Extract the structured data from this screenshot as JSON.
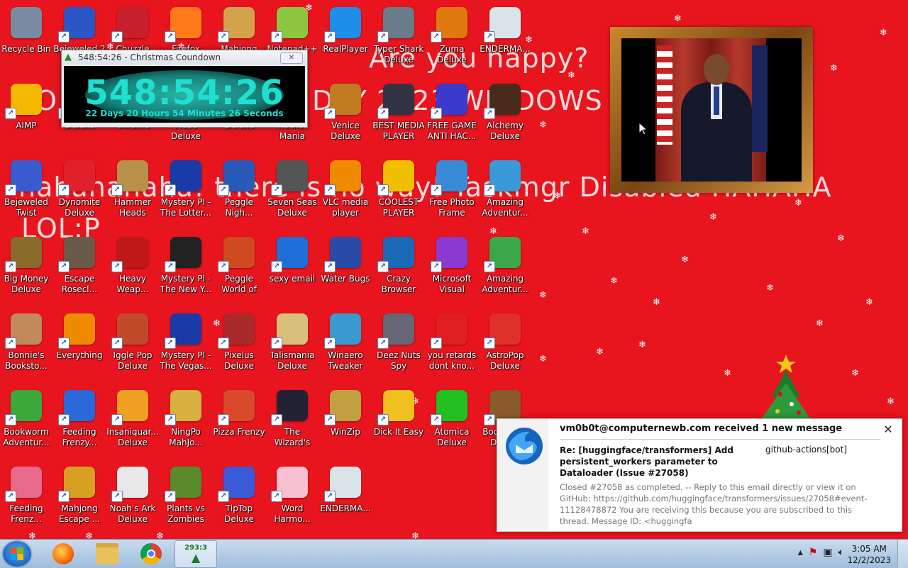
{
  "colors": {
    "wallpaper": "#e8141e",
    "countdown_text": "#1fe0d0",
    "notif_logo": "#1565c0"
  },
  "wallpaper": {
    "texts": [
      "Are you happy?",
      "O",
      "DAY 2023 WINDOWS",
      "hahahahaha! there is no way! Taskmgr Disabled HAHAHA",
      "LOL:P"
    ]
  },
  "desktop_icons": [
    {
      "label": "Recycle Bin",
      "icon": "recycle-bin-icon",
      "color": "#7a8aa0"
    },
    {
      "label": "Bejeweled 2 Deluxe",
      "icon": "bejeweled-2-icon",
      "color": "#2a57c8"
    },
    {
      "label": "Chuzzle Deluxe",
      "icon": "chuzzle-icon",
      "color": "#c8202a"
    },
    {
      "label": "Firefox",
      "icon": "firefox-icon",
      "color": "#ff7a1a"
    },
    {
      "label": "Mahjong",
      "icon": "mahjong-icon",
      "color": "#d4a24a"
    },
    {
      "label": "Notepad++",
      "icon": "notepad-plus-icon",
      "color": "#8dc63f"
    },
    {
      "label": "RealPlayer",
      "icon": "realplayer-icon",
      "color": "#1e8fe8"
    },
    {
      "label": "Typer Shark Deluxe",
      "icon": "typer-shark-icon",
      "color": "#6a7b8a"
    },
    {
      "label": "Zuma Deluxe",
      "icon": "zuma-icon",
      "color": "#e07a10"
    },
    {
      "label": "ENDERMA...",
      "icon": "window-icon",
      "color": "#d8e4ea"
    },
    {
      "label": "AIMP",
      "icon": "aimp-icon",
      "color": "#f5b800"
    },
    {
      "label": "Deluxe",
      "icon": "game-icon",
      "color": "#333"
    },
    {
      "label": "Chrome",
      "icon": "chrome-icon",
      "color": "#db4437"
    },
    {
      "label": "Maze Deluxe",
      "icon": "maze-icon",
      "color": "#884"
    },
    {
      "label": "Deluxe",
      "icon": "game-icon",
      "color": "#555"
    },
    {
      "label": "Rocket Mania Deluxe",
      "icon": "rocket-mania-icon",
      "color": "#1a7a2a"
    },
    {
      "label": "Venice Deluxe",
      "icon": "venice-icon",
      "color": "#c07a20"
    },
    {
      "label": "BEST MEDIA PLAYER 20...",
      "icon": "xm-play-icon",
      "color": "#334"
    },
    {
      "label": "FREE GAME ANTI HAC...",
      "icon": "anti-hack-icon",
      "color": "#3a3acc"
    },
    {
      "label": "Alchemy Deluxe",
      "icon": "alchemy-icon",
      "color": "#4a2a1a"
    },
    {
      "label": "Bejeweled Twist",
      "icon": "bejeweled-twist-icon",
      "color": "#3a5ad0"
    },
    {
      "label": "Dynomite Deluxe",
      "icon": "dynomite-icon",
      "color": "#e0202a"
    },
    {
      "label": "Hammer Heads Deluxe",
      "icon": "hammer-heads-icon",
      "color": "#b8904a"
    },
    {
      "label": "Mystery PI - The Lotter...",
      "icon": "mystery-pi-icon",
      "color": "#1a3aa8"
    },
    {
      "label": "Peggle Nigh...",
      "icon": "peggle-icon",
      "color": "#2a5ab8"
    },
    {
      "label": "Seven Seas Deluxe",
      "icon": "seven-seas-icon",
      "color": "#555"
    },
    {
      "label": "VLC media player",
      "icon": "vlc-icon",
      "color": "#f08a00"
    },
    {
      "label": "COOLEST PLAYER",
      "icon": "coolest-player-icon",
      "color": "#f0c000"
    },
    {
      "label": "Free Photo Frame",
      "icon": "photo-frame-icon",
      "color": "#3a8ad8"
    },
    {
      "label": "Amazing Adventur...",
      "icon": "amazing-adventures-icon",
      "color": "#3a9ad8"
    },
    {
      "label": "Big Money Deluxe",
      "icon": "big-money-icon",
      "color": "#8a6a2a"
    },
    {
      "label": "Escape Rosecl...",
      "icon": "escape-rosecliff-icon",
      "color": "#6a5a4a"
    },
    {
      "label": "Heavy Weap...",
      "icon": "heavy-weapon-icon",
      "color": "#c01818"
    },
    {
      "label": "Mystery PI - The New Y...",
      "icon": "mystery-pi-icon",
      "color": "#222"
    },
    {
      "label": "Peggle World of Warcraft ...",
      "icon": "peggle-wow-icon",
      "color": "#d04a20"
    },
    {
      "label": "sexy email",
      "icon": "thunderbird-icon",
      "color": "#1e6fd8"
    },
    {
      "label": "Water Bugs",
      "icon": "water-bugs-icon",
      "color": "#2a4aa8"
    },
    {
      "label": "Crazy Browser",
      "icon": "crazy-browser-icon",
      "color": "#1a6ab8"
    },
    {
      "label": "Microsoft Visual Stud...",
      "icon": "visual-studio-icon",
      "color": "#8a3ad0"
    },
    {
      "label": "Amazing Adventur...",
      "icon": "amazing-adventures-icon",
      "color": "#3aa84a"
    },
    {
      "label": "Bonnie's Booksto...",
      "icon": "bonnies-bookstore-icon",
      "color": "#c08a5a"
    },
    {
      "label": "Everything",
      "icon": "everything-icon",
      "color": "#f08a00"
    },
    {
      "label": "Iggle Pop Deluxe",
      "icon": "iggle-pop-icon",
      "color": "#c04a2a"
    },
    {
      "label": "Mystery PI - The Vegas...",
      "icon": "mystery-pi-icon",
      "color": "#1a3aa8"
    },
    {
      "label": "Pixelus Deluxe",
      "icon": "pixelus-icon",
      "color": "#a82a2a"
    },
    {
      "label": "Talismania Deluxe",
      "icon": "talismania-icon",
      "color": "#d8c07a"
    },
    {
      "label": "Winaero Tweaker",
      "icon": "winaero-icon",
      "color": "#3a9ad0"
    },
    {
      "label": "Deez Nuts Spy",
      "icon": "spy-icon",
      "color": "#667"
    },
    {
      "label": "you retards dont kno...",
      "icon": "you-retards-icon",
      "color": "#e02020"
    },
    {
      "label": "AstroPop Deluxe",
      "icon": "astropop-icon",
      "color": "#e0302a"
    },
    {
      "label": "Bookworm Adventur...",
      "icon": "bookworm-adventures-icon",
      "color": "#3aa83a"
    },
    {
      "label": "Feeding Frenzy...",
      "icon": "feeding-frenzy-icon",
      "color": "#2a6ad8"
    },
    {
      "label": "Insaniquar... Deluxe",
      "icon": "insaniquarium-icon",
      "color": "#f0a020"
    },
    {
      "label": "NingPo MahJo...",
      "icon": "ningpo-icon",
      "color": "#d8b040"
    },
    {
      "label": "Pizza Frenzy",
      "icon": "pizza-frenzy-icon",
      "color": "#d84a2a"
    },
    {
      "label": "The Wizard's Pen",
      "icon": "wizards-pen-icon",
      "color": "#223"
    },
    {
      "label": "WinZip",
      "icon": "winzip-icon",
      "color": "#c0a040"
    },
    {
      "label": "Dick It Easy",
      "icon": "de-icon",
      "color": "#f0c020"
    },
    {
      "label": "Atomica Deluxe",
      "icon": "atomica-icon",
      "color": "#20c020"
    },
    {
      "label": "Bookworm Deluxe",
      "icon": "bookworm-icon",
      "color": "#8a5a2a"
    },
    {
      "label": "Feeding Frenz...",
      "icon": "feeding-frenzy-icon",
      "color": "#e86a8a"
    },
    {
      "label": "Mahjong Escape ...",
      "icon": "mahjong-escape-icon",
      "color": "#d8a020"
    },
    {
      "label": "Noah's Ark Deluxe",
      "icon": "noahs-ark-icon",
      "color": "#e8e8e8"
    },
    {
      "label": "Plants vs Zombies",
      "icon": "pvz-icon",
      "color": "#5a8a2a"
    },
    {
      "label": "TipTop Deluxe",
      "icon": "tiptop-icon",
      "color": "#3a5ad8"
    },
    {
      "label": "Word Harmo...",
      "icon": "word-harmony-icon",
      "color": "#f8c0d0"
    },
    {
      "label": "ENDERMA...",
      "icon": "window-icon",
      "color": "#d8e4ea"
    }
  ],
  "countdown": {
    "title": "548:54:26 - Christmas Coundown",
    "big": "548:54:26",
    "small": "22 Days 20 Hours 54 Minutes 26 Seconds",
    "close": "✕"
  },
  "notification": {
    "sender": "vm0b0t@computernewb.com received 1 new message",
    "subject": "Re: [huggingface/transformers] Add persistent_workers parameter to Dataloader (Issue #27058)",
    "from": "github-actions[bot]",
    "preview": "Closed #27058 as completed. -- Reply to this email directly or view it on GitHub: https://github.com/huggingface/transformers/issues/27058#event-11128478872 You are receiving this because you are subscribed to this thread. Message ID: <huggingfa",
    "close": "✕"
  },
  "taskbar": {
    "countdown_badge": "293:3",
    "time": "3:05 AM",
    "date": "12/2/2023"
  }
}
